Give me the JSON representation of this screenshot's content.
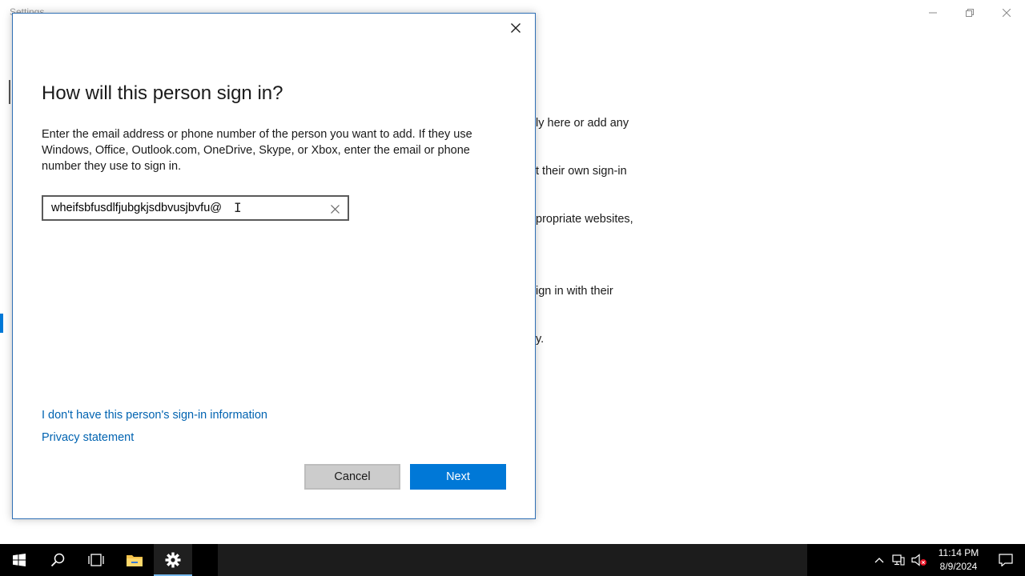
{
  "settings": {
    "window_title": "Settings",
    "bg_text_block1": [
      "ly here or add any",
      "t their own sign-in",
      "propriate websites,"
    ],
    "bg_text_block2": [
      "ign in with their",
      "y."
    ]
  },
  "dialog": {
    "heading": "How will this person sign in?",
    "description": "Enter the email address or phone number of the person you want to add. If they use Windows, Office, Outlook.com, OneDrive, Skype, or Xbox, enter the email or phone number they use to sign in.",
    "email_value": "wheifsbfusdlfjubgkjsdbvusjbvfu@",
    "email_placeholder": "",
    "no_info_link": "I don't have this person's sign-in information",
    "privacy_link": "Privacy statement",
    "cancel_label": "Cancel",
    "next_label": "Next",
    "close_icon": "close-icon",
    "clear_icon": "clear-icon"
  },
  "taskbar": {
    "icons": [
      "windows-start-icon",
      "search-icon",
      "task-view-icon",
      "file-explorer-icon",
      "settings-gear-icon"
    ],
    "tray_icons": [
      "chevron-up-icon",
      "network-icon",
      "volume-muted-icon"
    ],
    "time": "11:14 PM",
    "date": "8/9/2024",
    "accent_color": "#0078d7"
  }
}
